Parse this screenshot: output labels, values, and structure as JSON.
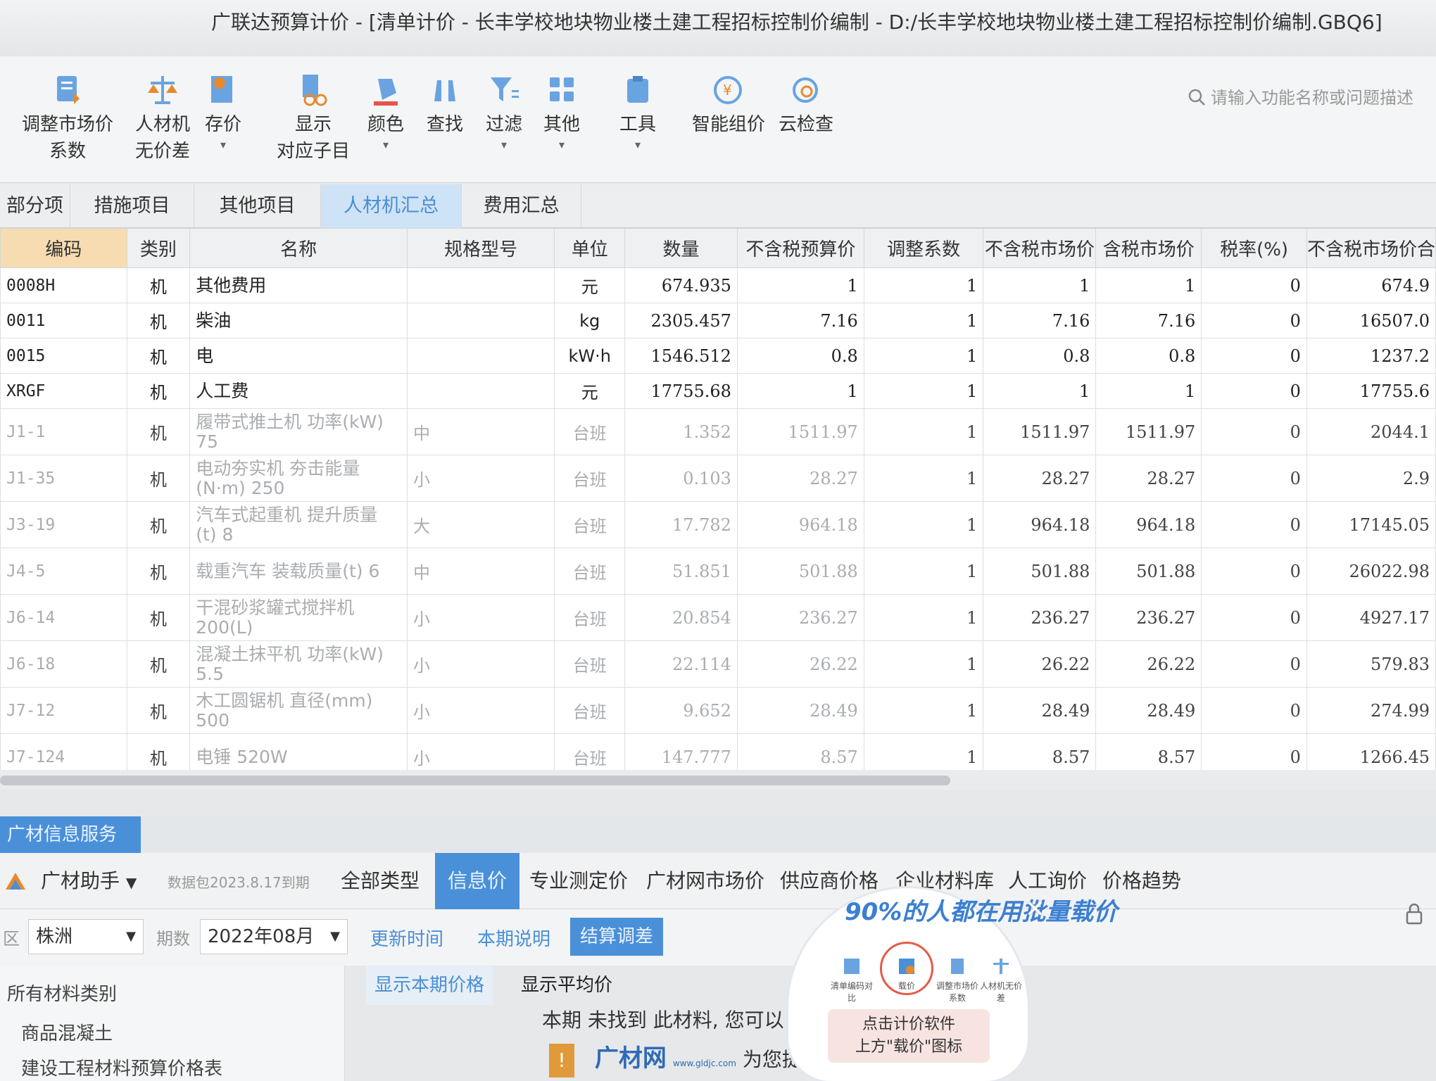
{
  "window": {
    "title": "广联达预算计价 - [清单计价 - 长丰学校地块物业楼土建工程招标控制价编制 - D:/长丰学校地块物业楼土建工程招标控制价编制.GBQ6]"
  },
  "toolbar": {
    "items": [
      {
        "line1": "调整市场价",
        "line2": "系数",
        "icon": "adjust-price-icon"
      },
      {
        "line1": "人材机",
        "line2": "无价差",
        "icon": "scale-icon"
      },
      {
        "line1": "存价",
        "line2": "",
        "icon": "save-price-icon"
      },
      {
        "line1": "显示",
        "line2": "对应子目",
        "icon": "show-items-icon"
      },
      {
        "line1": "颜色",
        "line2": "",
        "icon": "color-icon"
      },
      {
        "line1": "查找",
        "line2": "",
        "icon": "binoculars-icon"
      },
      {
        "line1": "过滤",
        "line2": "",
        "icon": "filter-icon"
      },
      {
        "line1": "其他",
        "line2": "",
        "icon": "grid-icon"
      },
      {
        "line1": "工具",
        "line2": "",
        "icon": "tools-icon"
      },
      {
        "line1": "智能组价",
        "line2": "",
        "icon": "smart-price-icon"
      },
      {
        "line1": "云检查",
        "line2": "",
        "icon": "cloud-check-icon"
      }
    ],
    "search_placeholder": "请输入功能名称或问题描述"
  },
  "tabs": [
    "部分项",
    "措施项目",
    "其他项目",
    "人材机汇总",
    "费用汇总"
  ],
  "active_tab": "人材机汇总",
  "table": {
    "columns": [
      "编码",
      "类别",
      "名称",
      "规格型号",
      "单位",
      "数量",
      "不含税预算价",
      "调整系数",
      "不含税市场价",
      "含税市场价",
      "税率(%)",
      "不含税市场价合"
    ],
    "rows": [
      {
        "code": "0008H",
        "cat": "机",
        "name": "其他费用",
        "spec": "",
        "unit": "元",
        "qty": "674.935",
        "budget": "1",
        "coef": "1",
        "mkt": "1",
        "mkt_tax": "1",
        "tax": "0",
        "total": "674.9",
        "grey": false
      },
      {
        "code": "0011",
        "cat": "机",
        "name": "柴油",
        "spec": "",
        "unit": "kg",
        "qty": "2305.457",
        "budget": "7.16",
        "coef": "1",
        "mkt": "7.16",
        "mkt_tax": "7.16",
        "tax": "0",
        "total": "16507.0",
        "grey": false
      },
      {
        "code": "0015",
        "cat": "机",
        "name": "电",
        "spec": "",
        "unit": "kW·h",
        "qty": "1546.512",
        "budget": "0.8",
        "coef": "1",
        "mkt": "0.8",
        "mkt_tax": "0.8",
        "tax": "0",
        "total": "1237.2",
        "grey": false
      },
      {
        "code": "XRGF",
        "cat": "机",
        "name": "人工费",
        "spec": "",
        "unit": "元",
        "qty": "17755.68",
        "budget": "1",
        "coef": "1",
        "mkt": "1",
        "mkt_tax": "1",
        "tax": "0",
        "total": "17755.6",
        "grey": false
      },
      {
        "code": "J1-1",
        "cat": "机",
        "name": "履带式推土机 功率(kW) 75",
        "spec": "中",
        "unit": "台班",
        "qty": "1.352",
        "budget": "1511.97",
        "coef": "1",
        "mkt": "1511.97",
        "mkt_tax": "1511.97",
        "tax": "0",
        "total": "2044.1",
        "grey": true
      },
      {
        "code": "J1-35",
        "cat": "机",
        "name": "电动夯实机 夯击能量 (N·m) 250",
        "spec": "小",
        "unit": "台班",
        "qty": "0.103",
        "budget": "28.27",
        "coef": "1",
        "mkt": "28.27",
        "mkt_tax": "28.27",
        "tax": "0",
        "total": "2.9",
        "grey": true
      },
      {
        "code": "J3-19",
        "cat": "机",
        "name": "汽车式起重机 提升质量 (t) 8",
        "spec": "大",
        "unit": "台班",
        "qty": "17.782",
        "budget": "964.18",
        "coef": "1",
        "mkt": "964.18",
        "mkt_tax": "964.18",
        "tax": "0",
        "total": "17145.05",
        "grey": true
      },
      {
        "code": "J4-5",
        "cat": "机",
        "name": "载重汽车 装载质量(t) 6",
        "spec": "中",
        "unit": "台班",
        "qty": "51.851",
        "budget": "501.88",
        "coef": "1",
        "mkt": "501.88",
        "mkt_tax": "501.88",
        "tax": "0",
        "total": "26022.98",
        "grey": true
      },
      {
        "code": "J6-14",
        "cat": "机",
        "name": "干混砂浆罐式搅拌机 200(L)",
        "spec": "小",
        "unit": "台班",
        "qty": "20.854",
        "budget": "236.27",
        "coef": "1",
        "mkt": "236.27",
        "mkt_tax": "236.27",
        "tax": "0",
        "total": "4927.17",
        "grey": true
      },
      {
        "code": "J6-18",
        "cat": "机",
        "name": "混凝土抹平机 功率(kW) 5.5",
        "spec": "小",
        "unit": "台班",
        "qty": "22.114",
        "budget": "26.22",
        "coef": "1",
        "mkt": "26.22",
        "mkt_tax": "26.22",
        "tax": "0",
        "total": "579.83",
        "grey": true
      },
      {
        "code": "J7-12",
        "cat": "机",
        "name": "木工圆锯机 直径(mm) 500",
        "spec": "小",
        "unit": "台班",
        "qty": "9.652",
        "budget": "28.49",
        "coef": "1",
        "mkt": "28.49",
        "mkt_tax": "28.49",
        "tax": "0",
        "total": "274.99",
        "grey": true
      },
      {
        "code": "J7-124",
        "cat": "机",
        "name": "电锤 520W",
        "spec": "小",
        "unit": "台班",
        "qty": "147.777",
        "budget": "8.57",
        "coef": "1",
        "mkt": "8.57",
        "mkt_tax": "8.57",
        "tax": "0",
        "total": "1266.45",
        "grey": true
      }
    ]
  },
  "bottom": {
    "header": "广材信息服务",
    "assistant": "广材助手",
    "assistant_sub": "数据包2023.8.17到期",
    "nav": [
      "全部类型",
      "信息价",
      "专业测定价",
      "广材网市场价",
      "供应商价格",
      "企业材料库",
      "人工询价",
      "价格趋势"
    ],
    "active_nav": "信息价",
    "region_label": "区",
    "region": "株洲",
    "period_label": "期数",
    "period": "2022年08月",
    "update_time": "更新时间",
    "period_note": "本期说明",
    "adjust_btn": "结算调差",
    "tree": [
      "所有材料类别",
      "商品混凝土",
      "建设工程材料预算价格表"
    ],
    "price_tabs": [
      "显示本期价格",
      "显示平均价"
    ],
    "notfound": "本期 未找到 此材料, 您可以",
    "brand": "广材网",
    "brand_url": "www.gldjc.com",
    "brand_suffix": "为您提"
  },
  "promo": {
    "title": "90%的人都在用批量载价",
    "icons": [
      "清单编码对比",
      "载价",
      "调整市场价系数",
      "人材机无价差"
    ],
    "note_line1": "点击计价软件",
    "note_line2": "上方\"载价\"图标"
  },
  "colors": {
    "accent": "#4a90d9",
    "selected_header": "#f6dcb0",
    "active_tab_bg": "#cfe3f6"
  }
}
